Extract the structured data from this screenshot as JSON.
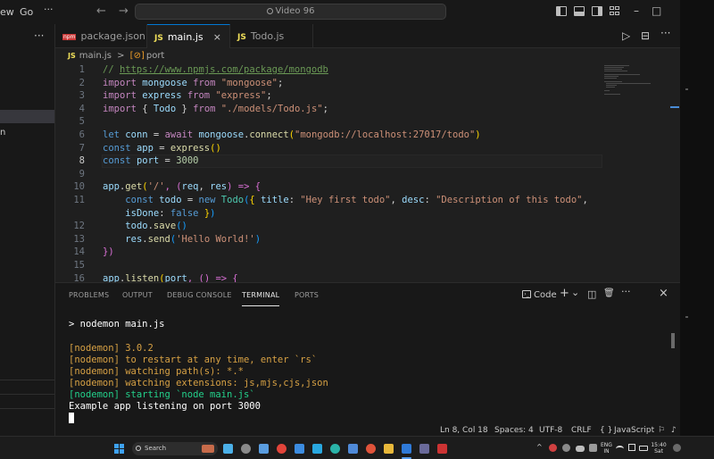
{
  "titlebar": {
    "menu_view": "ew",
    "menu_go": "Go",
    "more": "···",
    "back": "←",
    "forward": "→",
    "search_text": "Video 96",
    "minimize": "–",
    "maximize": "□"
  },
  "sidebar": {
    "dots": "···",
    "fragment": "n"
  },
  "tabs": [
    {
      "label": "package.json",
      "icon": "npm"
    },
    {
      "label": "main.js",
      "icon": "JS",
      "close": "×"
    },
    {
      "label": "Todo.js",
      "icon": "JS"
    }
  ],
  "tab_actions": {
    "run": "▷",
    "split": "⊟",
    "more": "···"
  },
  "breadcrumb": {
    "file": "main.js",
    "sep": ">",
    "symbol_icon": "[⊘]",
    "symbol": "port"
  },
  "editor": {
    "line_numbers": [
      "1",
      "2",
      "3",
      "4",
      "5",
      "6",
      "7",
      "8",
      "9",
      "10",
      "11",
      "",
      "12",
      "13",
      "14",
      "15",
      "16"
    ],
    "current_line": "8",
    "lines": [
      [
        "// ",
        "https://www.npmjs.com/package/mongodb"
      ],
      [
        "import",
        " mongoose ",
        "from",
        " ",
        "\"mongoose\"",
        ";"
      ],
      [
        "import",
        " express ",
        "from",
        " ",
        "\"express\"",
        ";"
      ],
      [
        "import",
        " { ",
        "Todo",
        " } ",
        "from",
        " ",
        "\"./models/Todo.js\"",
        ";"
      ],
      [],
      [
        "let",
        " ",
        "conn",
        " = ",
        "await",
        " ",
        "mongoose",
        ".",
        "connect",
        "(",
        "\"mongodb://localhost:27017/todo\"",
        ")"
      ],
      [
        "const",
        " ",
        "app",
        " = ",
        "express",
        "()"
      ],
      [
        "const",
        " ",
        "port",
        " = ",
        "3000"
      ],
      [],
      [
        "app",
        ".",
        "get",
        "(",
        "'/'",
        ", (",
        "req",
        ", ",
        "res",
        ") => {"
      ],
      [
        "    ",
        "const",
        " ",
        "todo",
        " = ",
        "new",
        " ",
        "Todo",
        "(",
        "{",
        " ",
        "title",
        ": ",
        "\"Hey first todo\"",
        ", ",
        "desc",
        ": ",
        "\"Description of this todo\"",
        ","
      ],
      [
        "    ",
        "isDone",
        ": ",
        "false",
        " ",
        "}",
        ")"
      ],
      [
        "    ",
        "todo",
        ".",
        "save",
        "()"
      ],
      [
        "    ",
        "res",
        ".",
        "send",
        "(",
        "'Hello World!'",
        ")"
      ],
      [
        "})"
      ],
      [],
      [
        "app",
        ".",
        "listen",
        "(",
        "port",
        ", () => {"
      ]
    ]
  },
  "panel": {
    "tabs": [
      "PROBLEMS",
      "OUTPUT",
      "DEBUG CONSOLE",
      "TERMINAL",
      "PORTS"
    ],
    "active_tab": "TERMINAL",
    "terminal_label": "Code",
    "actions": {
      "new": "+",
      "dropdown": "⌄",
      "split": "◫",
      "kill": "🗑",
      "more": "···",
      "close": "×"
    },
    "terminal_lines": [
      {
        "text": "> nodemon main.js",
        "style": "prompt"
      },
      {
        "text": "",
        "style": "prompt"
      },
      {
        "text": "[nodemon] 3.0.2",
        "style": "yellow"
      },
      {
        "text": "[nodemon] to restart at any time, enter `rs`",
        "style": "yellow"
      },
      {
        "text": "[nodemon] watching path(s): *.*",
        "style": "yellow"
      },
      {
        "text": "[nodemon] watching extensions: js,mjs,cjs,json",
        "style": "yellow"
      },
      {
        "text": "[nodemon] starting `node main.js`",
        "style": "green"
      },
      {
        "text": "Example app listening on port 3000",
        "style": "white"
      }
    ]
  },
  "statusbar": {
    "position": "Ln 8, Col 18",
    "spaces": "Spaces: 4",
    "encoding": "UTF-8",
    "eol": "CRLF",
    "braces": "{ }",
    "language": "JavaScript",
    "feedback": "⚐",
    "bell": "♪"
  },
  "taskbar": {
    "search_placeholder": "Search",
    "lang_top": "ENG",
    "lang_bottom": "IN",
    "time": "15:40",
    "day": "Sat",
    "chevron": "^"
  },
  "colors": {
    "accent": "#0078d4",
    "string": "#ce9178",
    "keyword": "#c586c0",
    "terminal_yellow": "#d7a144",
    "terminal_green": "#23d18b"
  }
}
